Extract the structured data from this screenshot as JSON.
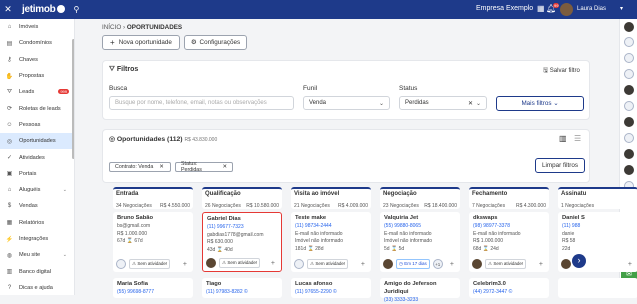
{
  "topbar": {
    "logo": "jetimob",
    "company": "Empresa Exemplo",
    "notification_badge": "99",
    "username": "Laura Dias"
  },
  "sidebar": {
    "items": [
      {
        "label": "Imóveis",
        "icon": "house-icon"
      },
      {
        "label": "Condomínios",
        "icon": "building-icon"
      },
      {
        "label": "Chaves",
        "icon": "key-icon"
      },
      {
        "label": "Propostas",
        "icon": "handshake-icon"
      },
      {
        "label": "Leads",
        "icon": "funnel-icon",
        "badge": "999"
      },
      {
        "label": "Roletas de leads",
        "icon": "roulette-icon"
      },
      {
        "label": "Pessoas",
        "icon": "people-icon"
      },
      {
        "label": "Oportunidades",
        "icon": "target-icon",
        "active": true
      },
      {
        "label": "Atividades",
        "icon": "check-icon"
      },
      {
        "label": "Portais",
        "icon": "portal-icon"
      },
      {
        "label": "Aluguéis",
        "icon": "rent-icon",
        "expand": true
      },
      {
        "label": "Vendas",
        "icon": "sales-icon"
      },
      {
        "label": "Relatórios",
        "icon": "report-icon"
      },
      {
        "label": "Integrações",
        "icon": "plug-icon"
      },
      {
        "label": "Meu site",
        "icon": "globe-icon",
        "expand": true
      },
      {
        "label": "Banco digital",
        "icon": "bank-icon"
      },
      {
        "label": "Dicas e ajuda",
        "icon": "help-icon"
      }
    ]
  },
  "breadcrumb": {
    "home": "INÍCIO",
    "current": "OPORTUNIDADES"
  },
  "actions": {
    "new": "Nova oportunidade",
    "config": "Configurações"
  },
  "filters": {
    "title": "Filtros",
    "save": "Salvar filtro",
    "search_label": "Busca",
    "search_placeholder": "Busque por nome, telefone, email, notas ou observações",
    "funnel_label": "Funil",
    "funnel_value": "Venda",
    "status_label": "Status",
    "status_value": "Perdidas",
    "more": "Mais filtros"
  },
  "summary": {
    "title": "Oportunidades (112)",
    "total": "R$ 43.830.000",
    "clear": "Limpar filtros"
  },
  "chips": [
    "Contrato: Venda",
    "Status: Perdidas"
  ],
  "columns": [
    {
      "name": "Entrada",
      "count": "34 Negociações",
      "amount": "R$ 4.550.000",
      "deals": [
        {
          "name": "Bruno Sabão",
          "phone": "",
          "email": "bs@gmail.com",
          "price": "R$ 1.000.000",
          "meta": "67d  ⌛ 67d",
          "activity": "Sem atividade!",
          "avatar": "empty"
        },
        {
          "name": "Maria Sofia",
          "phone": "(55) 99698-8777"
        }
      ]
    },
    {
      "name": "Qualificação",
      "count": "26 Negociações",
      "amount": "R$ 10.580.000",
      "deals": [
        {
          "name": "Gabriel Dias",
          "phone": "(11) 99677-7323",
          "email": "gabdias1778@gmail.com",
          "price": "R$ 630.000",
          "meta": "43d  ⌛ 40d",
          "activity": "Sem atividade!",
          "avatar": "photo",
          "selected": true
        },
        {
          "name": "Tiago",
          "phone": "(11) 97983-8282 ©"
        }
      ]
    },
    {
      "name": "Visita ao imóvel",
      "count": "21 Negociações",
      "amount": "R$ 4.009.000",
      "deals": [
        {
          "name": "Teste make",
          "phone": "(11) 98734-2444",
          "email": "E-mail não informado",
          "price": "Imóvel não informado",
          "meta": "181d  ⌛ 28d",
          "activity": "Sem atividade!",
          "avatar": "empty"
        },
        {
          "name": "Lucas afonso",
          "phone": "(11) 97655-2290 ©"
        }
      ]
    },
    {
      "name": "Negociação",
      "count": "23 Negociações",
      "amount": "R$ 18.400.000",
      "deals": [
        {
          "name": "Valquiria Jet",
          "phone": "(55) 99880-8065",
          "email": "E-mail não informado",
          "price": "Imóvel não informado",
          "meta": "5d  ⌛ 5d",
          "activity": "Em 17 dias",
          "avatar": "photo",
          "extra": "+1"
        },
        {
          "name": "Amigo do Jeferson Juridiqui",
          "phone": "(33) 3333-3233"
        }
      ]
    },
    {
      "name": "Fechamento",
      "count": "7 Negociações",
      "amount": "R$ 4.300.000",
      "deals": [
        {
          "name": "dkswaps",
          "phone": "(98) 98977-3378",
          "email": "E-mail não informado",
          "price": "R$ 1.000.000",
          "meta": "68d  ⌛ 24d",
          "activity": "Sem atividade!",
          "avatar": "photo"
        },
        {
          "name": "Celebrim3.0",
          "phone": "(44) 2972-3447 ©"
        }
      ]
    },
    {
      "name": "Assinatu",
      "count": "1 Negociações",
      "amount": "",
      "deals": [
        {
          "name": "Daniel S",
          "phone": "(11) 988",
          "email": "danie",
          "price": "R$ 58",
          "meta": "22d",
          "activity": "",
          "avatar": "photo"
        },
        {
          "name": "",
          "phone": ""
        }
      ]
    }
  ]
}
